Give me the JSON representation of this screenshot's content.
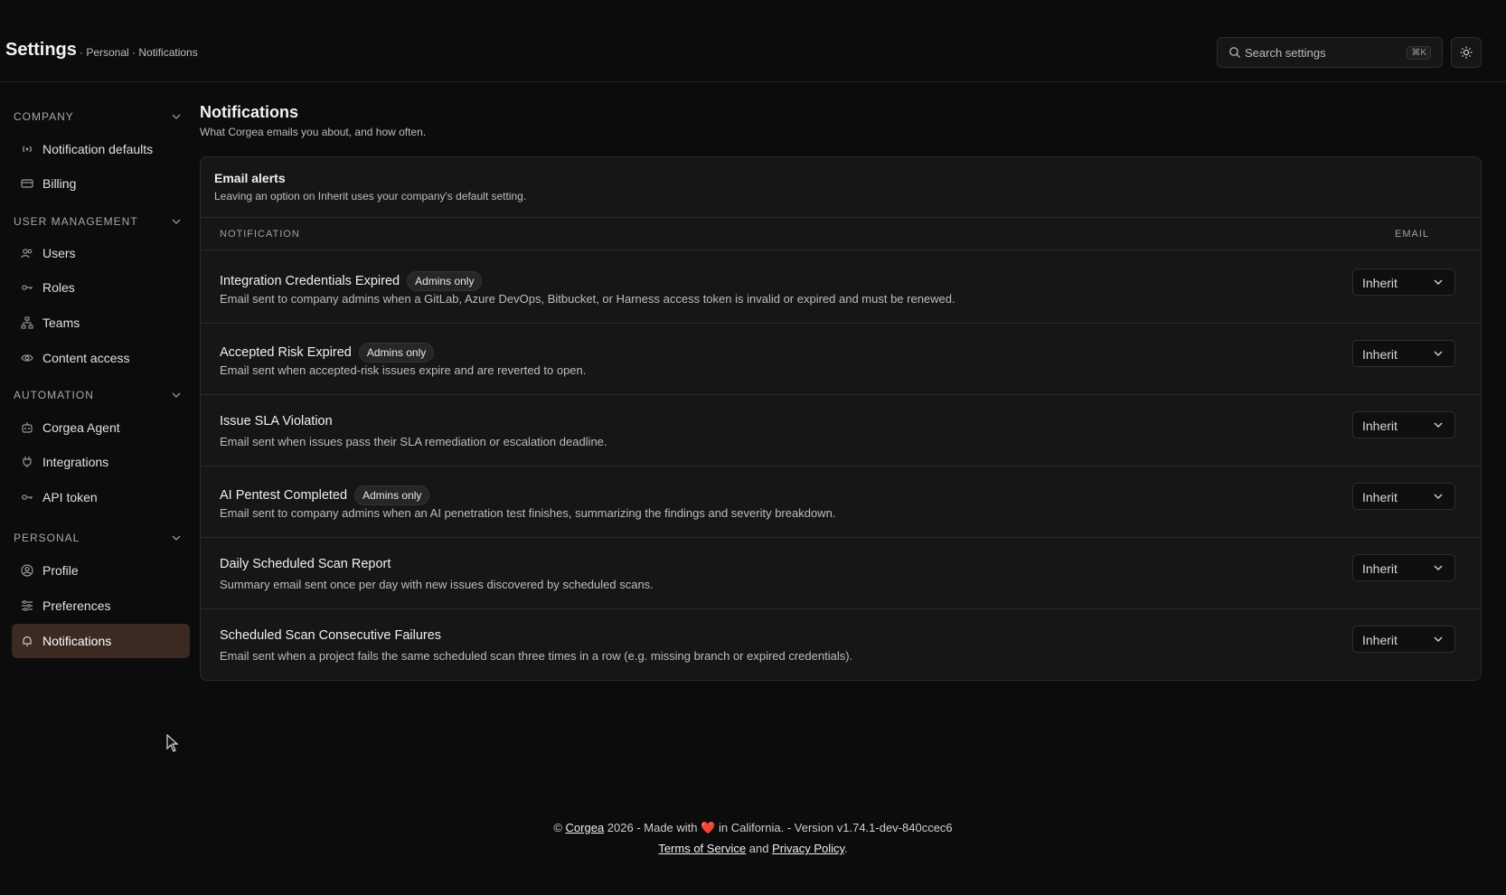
{
  "header": {
    "title": "Settings",
    "breadcrumb": "· Personal · Notifications",
    "search_placeholder": "Search settings",
    "search_shortcut": "⌘K"
  },
  "sidebar": {
    "sections": [
      {
        "label": "COMPANY",
        "items": [
          {
            "label": "Notification defaults",
            "icon": "broadcast-icon"
          },
          {
            "label": "Billing",
            "icon": "credit-card-icon"
          }
        ]
      },
      {
        "label": "USER MANAGEMENT",
        "items": [
          {
            "label": "Users",
            "icon": "users-icon"
          },
          {
            "label": "Roles",
            "icon": "key-icon"
          },
          {
            "label": "Teams",
            "icon": "org-chart-icon"
          },
          {
            "label": "Content access",
            "icon": "eye-icon"
          }
        ]
      },
      {
        "label": "AUTOMATION",
        "items": [
          {
            "label": "Corgea Agent",
            "icon": "robot-icon"
          },
          {
            "label": "Integrations",
            "icon": "plug-icon"
          },
          {
            "label": "API token",
            "icon": "key-icon"
          }
        ]
      },
      {
        "label": "PERSONAL",
        "items": [
          {
            "label": "Profile",
            "icon": "user-circle-icon"
          },
          {
            "label": "Preferences",
            "icon": "sliders-icon"
          },
          {
            "label": "Notifications",
            "icon": "bell-icon",
            "active": true
          }
        ]
      }
    ]
  },
  "main": {
    "title": "Notifications",
    "subtitle": "What Corgea emails you about, and how often.",
    "card": {
      "title": "Email alerts",
      "subtitle": "Leaving an option on Inherit uses your company's default setting.",
      "col_notification": "NOTIFICATION",
      "col_email": "EMAIL",
      "rows": [
        {
          "name": "Integration Credentials Expired",
          "badge": "Admins only",
          "desc": "Email sent to company admins when a GitLab, Azure DevOps, Bitbucket, or Harness access token is invalid or expired and must be renewed.",
          "value": "Inherit"
        },
        {
          "name": "Accepted Risk Expired",
          "badge": "Admins only",
          "desc": "Email sent when accepted-risk issues expire and are reverted to open.",
          "value": "Inherit"
        },
        {
          "name": "Issue SLA Violation",
          "badge": "",
          "desc": "Email sent when issues pass their SLA remediation or escalation deadline.",
          "value": "Inherit"
        },
        {
          "name": "AI Pentest Completed",
          "badge": "Admins only",
          "desc": "Email sent to company admins when an AI penetration test finishes, summarizing the findings and severity breakdown.",
          "value": "Inherit"
        },
        {
          "name": "Daily Scheduled Scan Report",
          "badge": "",
          "desc": "Summary email sent once per day with new issues discovered by scheduled scans.",
          "value": "Inherit"
        },
        {
          "name": "Scheduled Scan Consecutive Failures",
          "badge": "",
          "desc": "Email sent when a project fails the same scheduled scan three times in a row (e.g. missing branch or expired credentials).",
          "value": "Inherit"
        }
      ]
    }
  },
  "footer": {
    "prefix": "©",
    "brand": "Corgea",
    "made_with": "2026 - Made with",
    "heart": "❤️",
    "suffix": "in California. - Version v1.74.1-dev-840ccec6",
    "terms": "Terms of Service",
    "and": "and",
    "privacy": "Privacy Policy"
  },
  "colors": {
    "accent_active": "#3a2a22",
    "background": "#0c0c0c",
    "card": "#161616"
  }
}
